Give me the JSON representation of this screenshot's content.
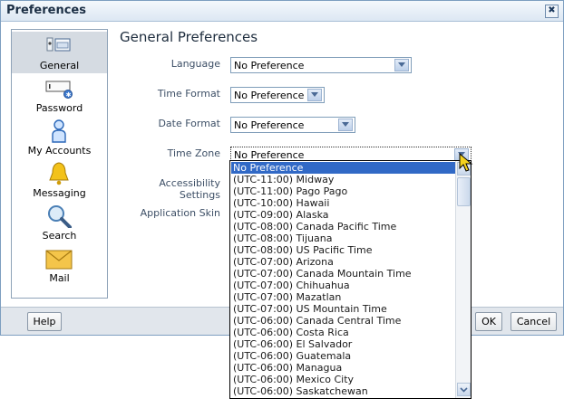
{
  "dialog": {
    "title": "Preferences",
    "close_label": "✖"
  },
  "sidebar": {
    "items": [
      {
        "label": "General",
        "icon": "general-prefs-icon",
        "selected": true
      },
      {
        "label": "Password",
        "icon": "password-icon"
      },
      {
        "label": "My Accounts",
        "icon": "my-accounts-icon"
      },
      {
        "label": "Messaging",
        "icon": "bell-icon"
      },
      {
        "label": "Search",
        "icon": "magnifier-icon"
      },
      {
        "label": "Mail",
        "icon": "envelope-icon"
      }
    ]
  },
  "main": {
    "heading": "General Preferences",
    "fields": {
      "language": {
        "label": "Language",
        "value": "No Preference"
      },
      "time_format": {
        "label": "Time Format",
        "value": "No Preference"
      },
      "date_format": {
        "label": "Date Format",
        "value": "No Preference"
      },
      "time_zone": {
        "label": "Time Zone",
        "value": "No Preference"
      },
      "accessibility": {
        "label": "Accessibility Settings"
      },
      "skin": {
        "label": "Application Skin"
      }
    }
  },
  "footer": {
    "help_label": "Help",
    "ok_label": "OK",
    "cancel_label": "Cancel"
  },
  "timezone_options": [
    "No Preference",
    "(UTC-11:00) Midway",
    "(UTC-11:00) Pago Pago",
    "(UTC-10:00) Hawaii",
    "(UTC-09:00) Alaska",
    "(UTC-08:00) Canada Pacific Time",
    "(UTC-08:00) Tijuana",
    "(UTC-08:00) US Pacific Time",
    "(UTC-07:00) Arizona",
    "(UTC-07:00) Canada Mountain Time",
    "(UTC-07:00) Chihuahua",
    "(UTC-07:00) Mazatlan",
    "(UTC-07:00) US Mountain Time",
    "(UTC-06:00) Canada Central Time",
    "(UTC-06:00) Costa Rica",
    "(UTC-06:00) El Salvador",
    "(UTC-06:00) Guatemala",
    "(UTC-06:00) Managua",
    "(UTC-06:00) Mexico City",
    "(UTC-06:00) Saskatchewan"
  ],
  "colors": {
    "highlight": "#3169c6",
    "title_text": "#1c2f45",
    "label_text": "#3d4f66"
  }
}
